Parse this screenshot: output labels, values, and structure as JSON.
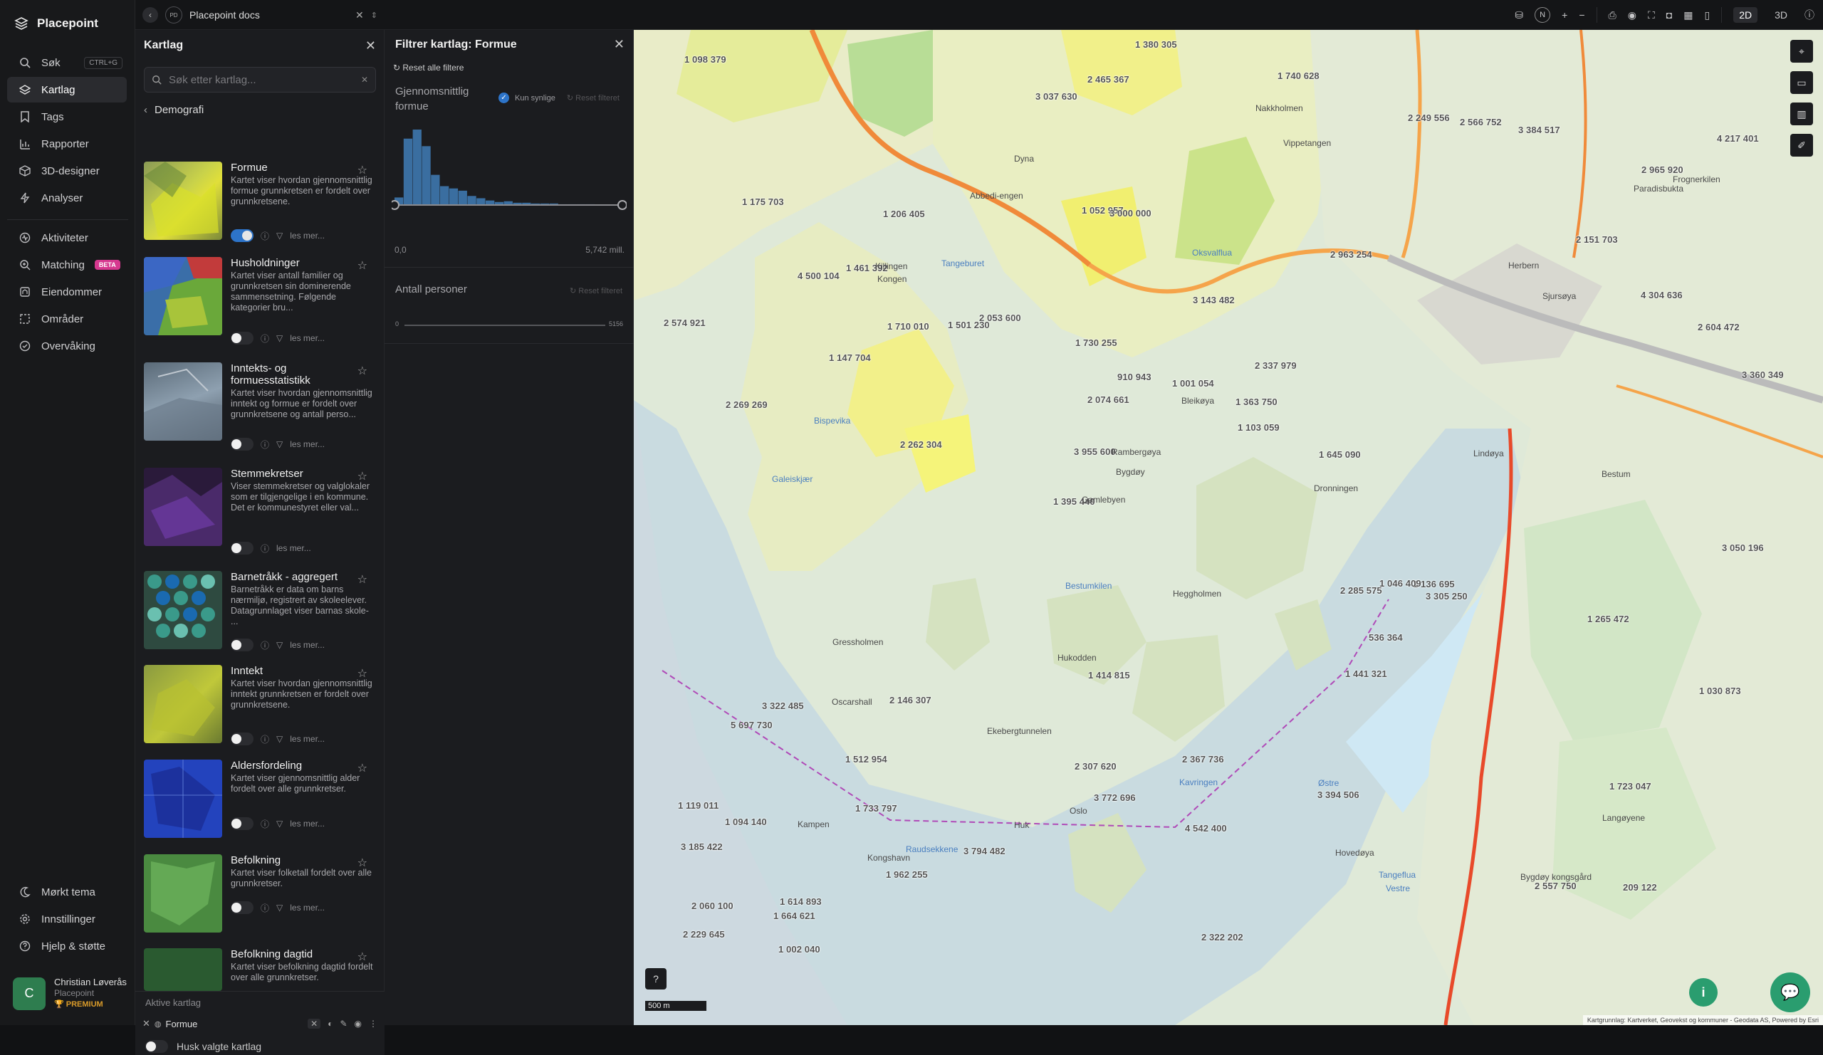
{
  "app": {
    "name": "Placepoint"
  },
  "nav": {
    "items": [
      {
        "label": "Søk",
        "icon": "search-icon",
        "shortcut": "CTRL+G"
      },
      {
        "label": "Kartlag",
        "icon": "layers-icon",
        "active": true
      },
      {
        "label": "Tags",
        "icon": "bookmark-icon"
      },
      {
        "label": "Rapporter",
        "icon": "bar-chart-icon"
      },
      {
        "label": "3D-designer",
        "icon": "cube-icon"
      },
      {
        "label": "Analyser",
        "icon": "bolt-icon"
      },
      {
        "label": "Aktiviteter",
        "icon": "activity-icon"
      },
      {
        "label": "Matching",
        "icon": "match-icon",
        "badge": "BETA"
      },
      {
        "label": "Eiendommer",
        "icon": "property-icon"
      },
      {
        "label": "Områder",
        "icon": "area-icon"
      },
      {
        "label": "Overvåking",
        "icon": "monitor-icon"
      }
    ],
    "bottom": [
      {
        "label": "Mørkt tema",
        "icon": "moon-icon"
      },
      {
        "label": "Innstillinger",
        "icon": "gear-icon"
      },
      {
        "label": "Hjelp & støtte",
        "icon": "help-icon"
      }
    ]
  },
  "user": {
    "initial": "C",
    "name": "Christian Løverås",
    "org": "Placepoint",
    "plan": "PREMIUM"
  },
  "topbar": {
    "doc_initials": "PD",
    "doc_name": "Placepoint docs",
    "modes": [
      "2D",
      "3D"
    ],
    "active_mode": "2D",
    "compass": "N"
  },
  "layers_panel": {
    "title": "Kartlag",
    "search_placeholder": "Søk etter kartlag...",
    "category": "Demografi",
    "read_more": "les mer...",
    "cards": [
      {
        "title": "Formue",
        "desc": "Kartet viser hvordan gjennomsnittlig formue grunnkretsen er fordelt over grunnkretsene.",
        "enabled": true,
        "filter": true
      },
      {
        "title": "Husholdninger",
        "desc": "Kartet viser antall familier og grunnkretsen sin dominerende sammensetning. Følgende kategorier bru...",
        "enabled": false,
        "filter": true
      },
      {
        "title": "Inntekts- og formuesstatistikk",
        "desc": "Kartet viser hvordan gjennomsnittlig inntekt og formue er fordelt over grunnkretsene og antall perso...",
        "enabled": false,
        "filter": true
      },
      {
        "title": "Stemmekretser",
        "desc": "Viser stemmekretser og valglokaler som er tilgjengelige i en kommune. Det er kommunestyret eller val...",
        "enabled": false,
        "filter": false
      },
      {
        "title": "Barnetråkk - aggregert",
        "desc": "Barnetråkk er data om barns nærmiljø, registrert av skoleelever. Datagrunnlaget viser barnas skole- ...",
        "enabled": false,
        "filter": true
      },
      {
        "title": "Inntekt",
        "desc": "Kartet viser hvordan gjennomsnittlig inntekt grunnkretsen er fordelt over grunnkretsene.",
        "enabled": false,
        "filter": true
      },
      {
        "title": "Aldersfordeling",
        "desc": "Kartet viser gjennomsnittlig alder fordelt over alle grunnkretser.",
        "enabled": false,
        "filter": true
      },
      {
        "title": "Befolkning",
        "desc": "Kartet viser folketall fordelt over alle grunnkretser.",
        "enabled": false,
        "filter": true
      },
      {
        "title": "Befolkning dagtid",
        "desc": "Kartet viser befolkning dagtid fordelt over alle grunnkretser.",
        "enabled": false,
        "filter": true
      }
    ],
    "active_label": "Aktive kartlag",
    "active_layer": "Formue",
    "keep_label": "Husk valgte kartlag"
  },
  "filter_panel": {
    "title": "Filtrer kartlag: Formue",
    "reset_all": "Reset alle filtere",
    "attr1": {
      "name": "Gjennomsnittlig formue",
      "only_visible": "Kun synlige",
      "reset": "Reset filteret",
      "min": "0,0",
      "max": "5,742 mill.",
      "histogram": [
        10,
        88,
        100,
        78,
        40,
        25,
        22,
        19,
        12,
        9,
        6,
        4,
        5,
        3,
        3,
        2,
        2,
        2,
        1,
        1,
        1,
        1,
        0.5,
        0.5,
        0.5
      ]
    },
    "attr2": {
      "name": "Antall personer",
      "reset": "Reset filteret",
      "min": "0",
      "max": "5156"
    }
  },
  "map": {
    "scale_label": "500 m",
    "attribution": "Kartgrunnlag: Kartverket, Geovekst og kommuner - Geodata AS, Powered by Esri",
    "values": [
      "209 122",
      "2 269 269",
      "2 965 920",
      "1 395 440",
      "2 963 254",
      "1 614 893",
      "1 052 957",
      "3 143 482",
      "3 322 485",
      "2 053 600",
      "3 185 422",
      "1 733 797",
      "3 000 000",
      "2 337 979",
      "3 305 250",
      "1 175 703",
      "2 465 367",
      "3 360 349",
      "2 285 575",
      "4 304 636",
      "3 955 600",
      "2 307 620",
      "2 074 661",
      "1 206 405",
      "2 249 556",
      "2 146 307",
      "2 557 750",
      "1 723 047",
      "1 136 695",
      "2 322 202",
      "1 501 230",
      "1 147 704",
      "1 441 321",
      "1 962 255",
      "2 604 472",
      "1 363 750",
      "2 060 100",
      "3 772 696",
      "1 103 059",
      "5 697 730",
      "2 151 703",
      "4 217 401",
      "536 364",
      "3 394 506",
      "1 512 954",
      "1 002 040",
      "2 229 645",
      "2 367 736",
      "3 384 517",
      "1 380 305",
      "2 262 304",
      "2 574 921",
      "1 461 392",
      "2 566 752",
      "1 664 621",
      "1 740 628",
      "3 037 630",
      "910 943",
      "1 030 873",
      "1 414 815",
      "3 794 482",
      "1 046 409",
      "1 710 010",
      "1 119 011",
      "1 098 379",
      "4 500 104",
      "3 050 196",
      "1 730 255",
      "4 542 400",
      "1 001 054",
      "1 094 140",
      "1 645 090",
      "1 265 472"
    ],
    "places": [
      "Abbedi-engen",
      "Bestum",
      "Bygdøy",
      "Bygdøy kongsgård",
      "Oscarshall",
      "Kongen",
      "Dronningen",
      "Huk",
      "Hukodden",
      "Paradisbukta",
      "Herbern",
      "Dyna",
      "Killingen",
      "Frognerkilen",
      "Oslo",
      "Vippetangen",
      "Kongshavn",
      "Sjursøya",
      "Nakkholmen",
      "Hovedøya",
      "Gressholmen",
      "Rambergøya",
      "Lindøya",
      "Bleikøya",
      "Heggholmen",
      "Langøyene",
      "Ekebergtunnelen",
      "Kampen",
      "Gamlebyen"
    ],
    "waters": [
      "Bestumkilen",
      "Tangeflua",
      "Raudsekkene",
      "Kavringen",
      "Galeiskjær",
      "Bispevika",
      "Tangeburet",
      "Oksvalflua",
      "Østre",
      "Vestre"
    ]
  }
}
